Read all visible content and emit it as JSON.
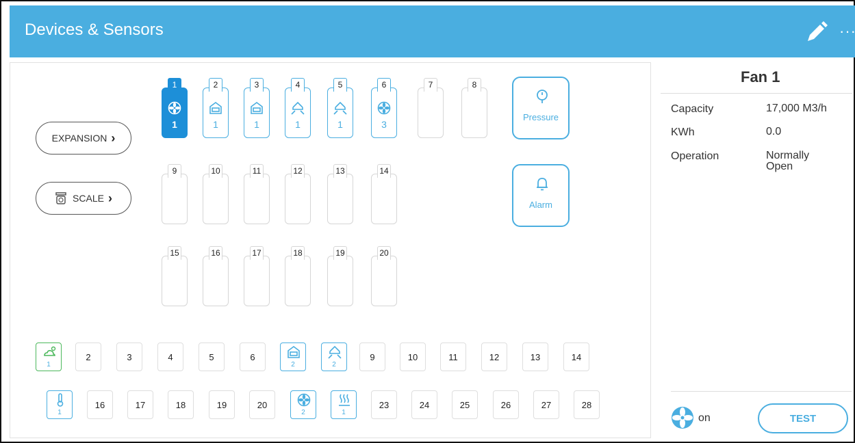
{
  "header": {
    "title": "Devices & Sensors",
    "more": "···"
  },
  "buttons": {
    "expansion": "EXPANSION",
    "scale": "SCALE",
    "pressure": "Pressure",
    "alarm": "Alarm"
  },
  "slots": [
    {
      "label": "1",
      "icon": "fan-icon",
      "count": "1",
      "selected": true
    },
    {
      "label": "2",
      "icon": "inlet-open-icon",
      "count": "1"
    },
    {
      "label": "3",
      "icon": "inlet-closed-icon",
      "count": "1"
    },
    {
      "label": "4",
      "icon": "tunnel-open-icon",
      "count": "1"
    },
    {
      "label": "5",
      "icon": "tunnel-closed-icon",
      "count": "1"
    },
    {
      "label": "6",
      "icon": "fan-icon",
      "count": "3"
    },
    {
      "label": "7"
    },
    {
      "label": "8"
    },
    {
      "label": "9"
    },
    {
      "label": "10"
    },
    {
      "label": "11"
    },
    {
      "label": "12"
    },
    {
      "label": "13"
    },
    {
      "label": "14"
    },
    {
      "label": "15"
    },
    {
      "label": "16"
    },
    {
      "label": "17"
    },
    {
      "label": "18"
    },
    {
      "label": "19"
    },
    {
      "label": "20"
    }
  ],
  "bottom_row1": [
    {
      "label": "",
      "icon": "weather-icon",
      "count": "1",
      "green": true
    },
    {
      "label": "2"
    },
    {
      "label": "3"
    },
    {
      "label": "4"
    },
    {
      "label": "5"
    },
    {
      "label": "6"
    },
    {
      "label": "",
      "icon": "inlet-open-icon",
      "count": "2"
    },
    {
      "label": "",
      "icon": "tunnel-open-icon",
      "count": "2"
    },
    {
      "label": "9"
    },
    {
      "label": "10"
    },
    {
      "label": "11"
    },
    {
      "label": "12"
    },
    {
      "label": "13"
    },
    {
      "label": "14"
    }
  ],
  "bottom_row2": [
    {
      "label": "",
      "icon": "thermometer-icon",
      "count": "1"
    },
    {
      "label": "16"
    },
    {
      "label": "17"
    },
    {
      "label": "18"
    },
    {
      "label": "19"
    },
    {
      "label": "20"
    },
    {
      "label": "",
      "icon": "fan-icon",
      "count": "2"
    },
    {
      "label": "",
      "icon": "heater-icon",
      "count": "1"
    },
    {
      "label": "23"
    },
    {
      "label": "24"
    },
    {
      "label": "25"
    },
    {
      "label": "26"
    },
    {
      "label": "27"
    },
    {
      "label": "28"
    }
  ],
  "side": {
    "title": "Fan 1",
    "props": [
      {
        "key": "Capacity",
        "value": "17,000 M3/h"
      },
      {
        "key": "KWh",
        "value": "0.0"
      },
      {
        "key": "Operation",
        "value": "Normally Open"
      }
    ],
    "status": "on",
    "test": "TEST"
  },
  "colors": {
    "accent": "#4aaee0",
    "selected": "#1d8fd8",
    "green": "#4cb85c"
  }
}
